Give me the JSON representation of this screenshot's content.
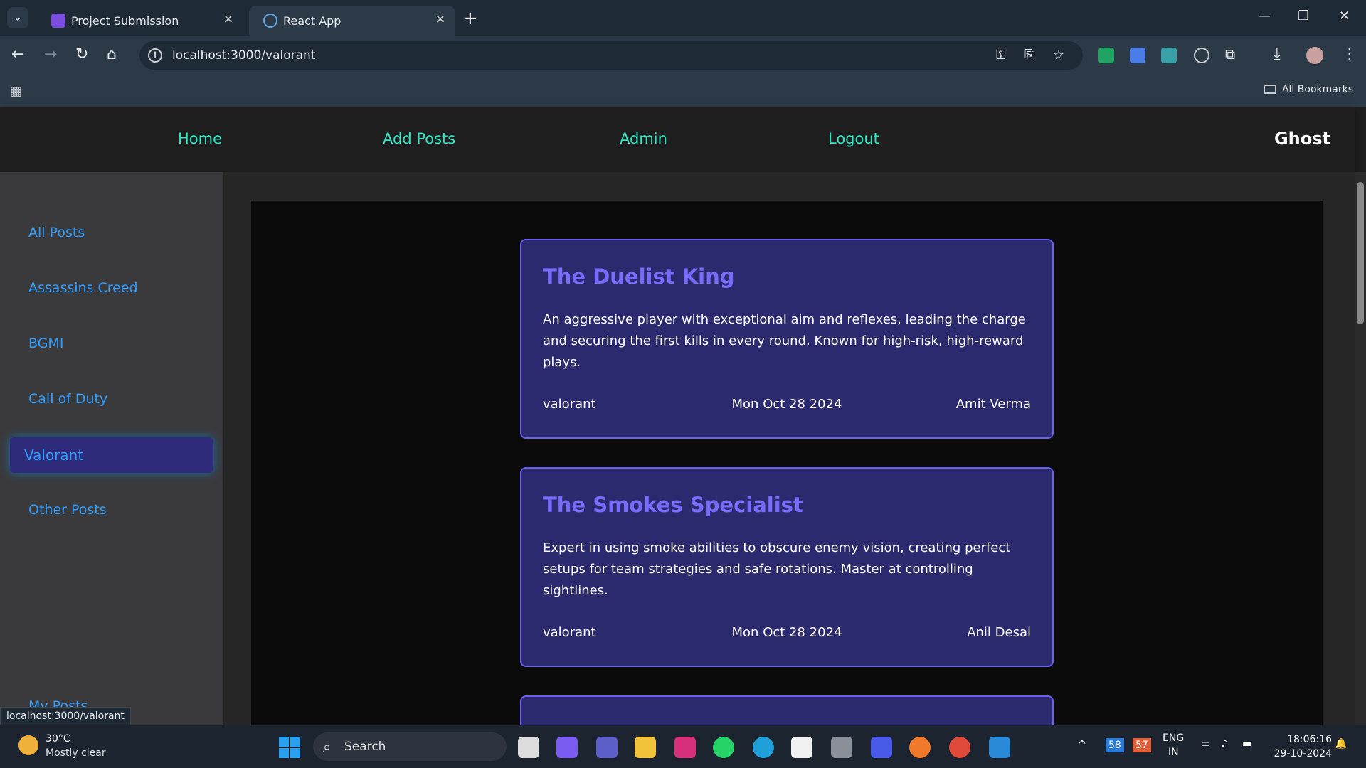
{
  "browser": {
    "tabs": [
      {
        "label": "Project Submission",
        "close": "✕"
      },
      {
        "label": "React App",
        "close": "✕"
      }
    ],
    "new_tab": "+",
    "tab_dropdown": "⌄",
    "url": "localhost:3000/valorant",
    "all_bookmarks": "All Bookmarks",
    "window_controls": {
      "minimize": "—",
      "restore": "❐",
      "close": "✕"
    },
    "nav": {
      "back": "←",
      "forward": "→",
      "reload": "↻",
      "home": "⌂"
    }
  },
  "navbar": {
    "links": [
      "Home",
      "Add Posts",
      "Admin",
      "Logout"
    ],
    "brand": "Ghost"
  },
  "sidebar": {
    "items": [
      "All Posts",
      "Assassins Creed",
      "BGMI",
      "Call of Duty",
      "Valorant",
      "Other Posts",
      "My Posts"
    ],
    "active": "Valorant"
  },
  "posts": [
    {
      "title": "The Duelist King",
      "body": "An aggressive player with exceptional aim and reflexes, leading the charge and securing the first kills in every round. Known for high-risk, high-reward plays.",
      "category": "valorant",
      "date": "Mon Oct 28 2024",
      "author": "Amit Verma"
    },
    {
      "title": "The Smokes Specialist",
      "body": "Expert in using smoke abilities to obscure enemy vision, creating perfect setups for team strategies and safe rotations. Master at controlling sightlines.",
      "category": "valorant",
      "date": "Mon Oct 28 2024",
      "author": "Anil Desai"
    }
  ],
  "status_url": "localhost:3000/valorant",
  "taskbar": {
    "weather_temp": "30°C",
    "weather_desc": "Mostly clear",
    "search": "Search",
    "badge1": "58",
    "badge2": "57",
    "lang1": "ENG",
    "lang2": "IN",
    "time": "18:06:16",
    "date": "29-10-2024"
  }
}
